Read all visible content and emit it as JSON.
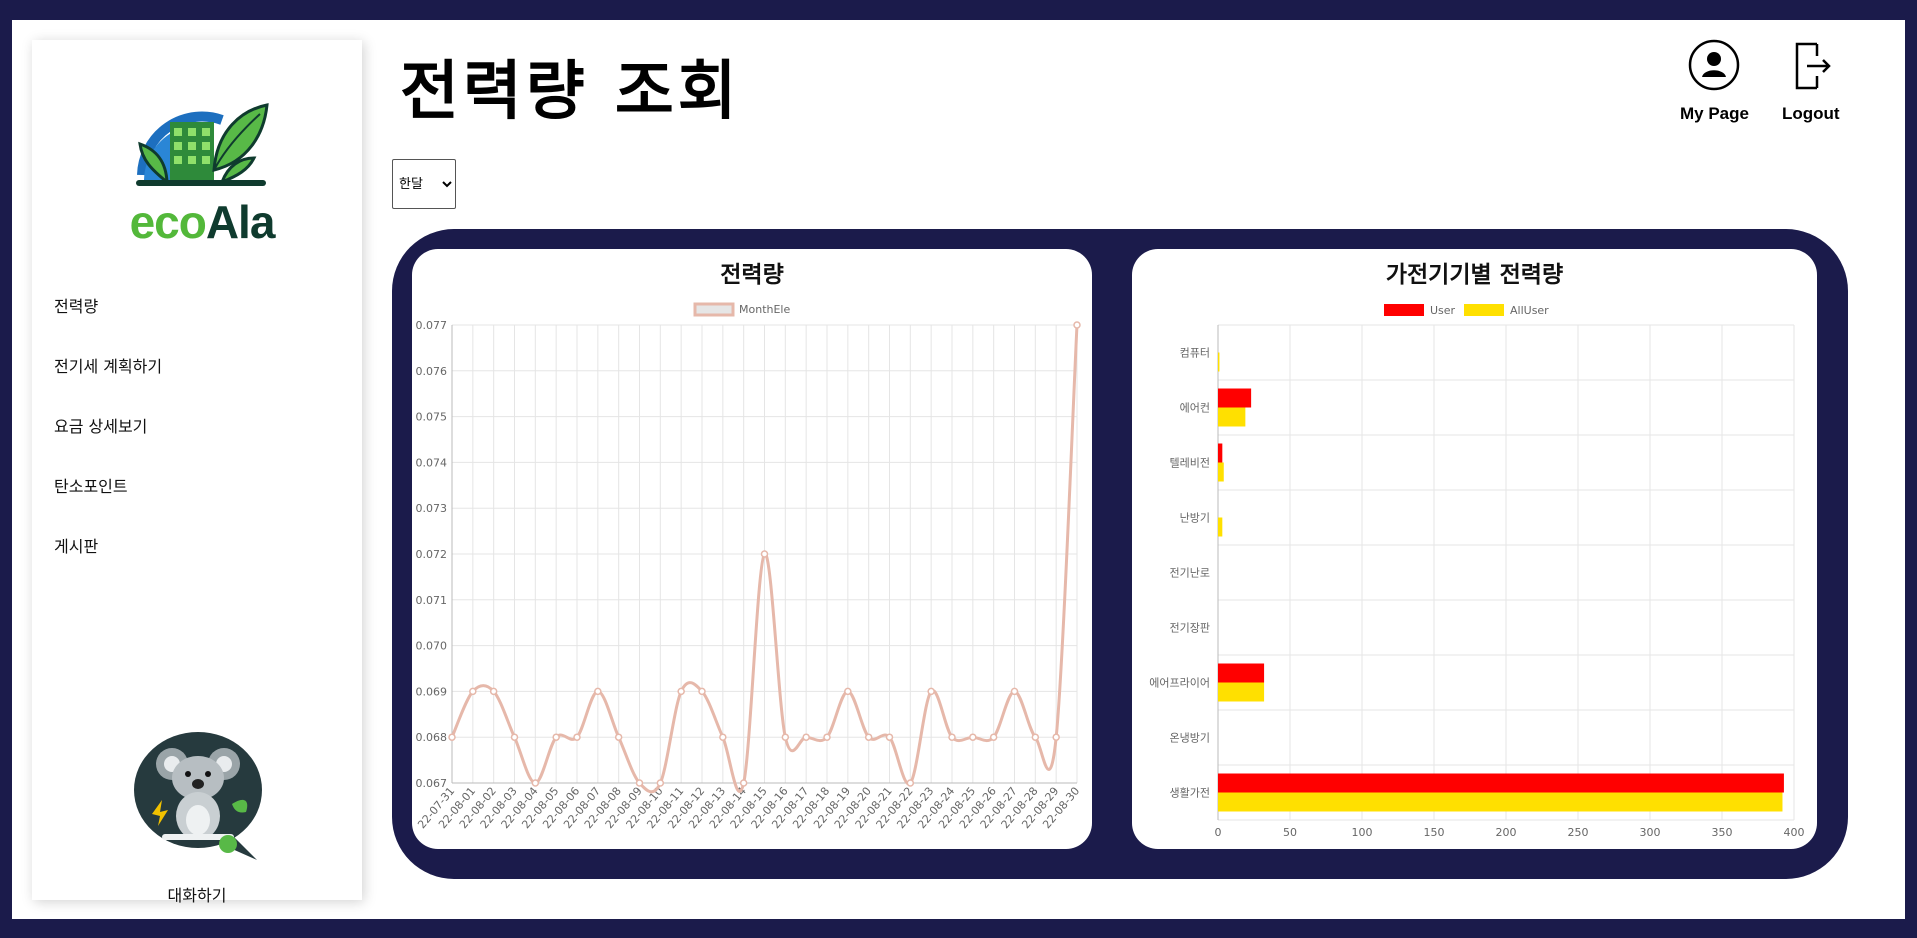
{
  "app": {
    "logo_text_1": "eco",
    "logo_text_2": "Ala",
    "page_title": "전력량 조회",
    "accent": "#1b1b4b"
  },
  "header": {
    "mypage_label": "My Page",
    "logout_label": "Logout"
  },
  "sidebar": {
    "items": [
      {
        "label": "전력량"
      },
      {
        "label": "전기세 계획하기"
      },
      {
        "label": "요금 상세보기"
      },
      {
        "label": "탄소포인트"
      },
      {
        "label": "게시판"
      }
    ],
    "chat_label": "대화하기"
  },
  "filter": {
    "selected": "한달",
    "options": [
      "한달"
    ]
  },
  "chart_data": [
    {
      "type": "line",
      "title": "전력량",
      "series": [
        {
          "name": "MonthEle",
          "color": "#e6b8aa",
          "values": [
            0.068,
            0.069,
            0.069,
            0.068,
            0.067,
            0.068,
            0.068,
            0.069,
            0.068,
            0.067,
            0.067,
            0.069,
            0.069,
            0.068,
            0.067,
            0.072,
            0.068,
            0.068,
            0.068,
            0.069,
            0.068,
            0.068,
            0.067,
            0.069,
            0.068,
            0.068,
            0.068,
            0.069,
            0.068,
            0.068,
            0.077
          ]
        }
      ],
      "x": [
        "22-07-31",
        "22-08-01",
        "22-08-02",
        "22-08-03",
        "22-08-04",
        "22-08-05",
        "22-08-06",
        "22-08-07",
        "22-08-08",
        "22-08-09",
        "22-08-10",
        "22-08-11",
        "22-08-12",
        "22-08-13",
        "22-08-14",
        "22-08-15",
        "22-08-16",
        "22-08-17",
        "22-08-18",
        "22-08-19",
        "22-08-20",
        "22-08-21",
        "22-08-22",
        "22-08-23",
        "22-08-24",
        "22-08-25",
        "22-08-26",
        "22-08-27",
        "22-08-28",
        "22-08-29",
        "22-08-30"
      ],
      "ylim": [
        0.067,
        0.077
      ],
      "yticks": [
        "0.077",
        "0.076",
        "0.075",
        "0.074",
        "0.073",
        "0.072",
        "0.071",
        "0.070",
        "0.069",
        "0.068",
        "0.067"
      ],
      "legend": "top",
      "grid": true
    },
    {
      "type": "bar",
      "orientation": "horizontal",
      "title": "가전기기별 전력량",
      "categories": [
        "컴퓨터",
        "에어컨",
        "텔레비전",
        "난방기",
        "전기난로",
        "전기장판",
        "에어프라이어",
        "온냉방기",
        "생활가전"
      ],
      "series": [
        {
          "name": "User",
          "color": "#ff0000",
          "values": [
            0,
            23,
            3,
            0,
            0,
            0,
            32,
            0,
            393
          ]
        },
        {
          "name": "AllUser",
          "color": "#ffe000",
          "values": [
            1,
            19,
            4,
            3,
            0,
            0,
            32,
            0,
            392
          ]
        }
      ],
      "xlim": [
        0,
        400
      ],
      "xticks": [
        "0",
        "50",
        "100",
        "150",
        "200",
        "250",
        "300",
        "350",
        "400"
      ],
      "legend": "top",
      "grid": true
    }
  ]
}
